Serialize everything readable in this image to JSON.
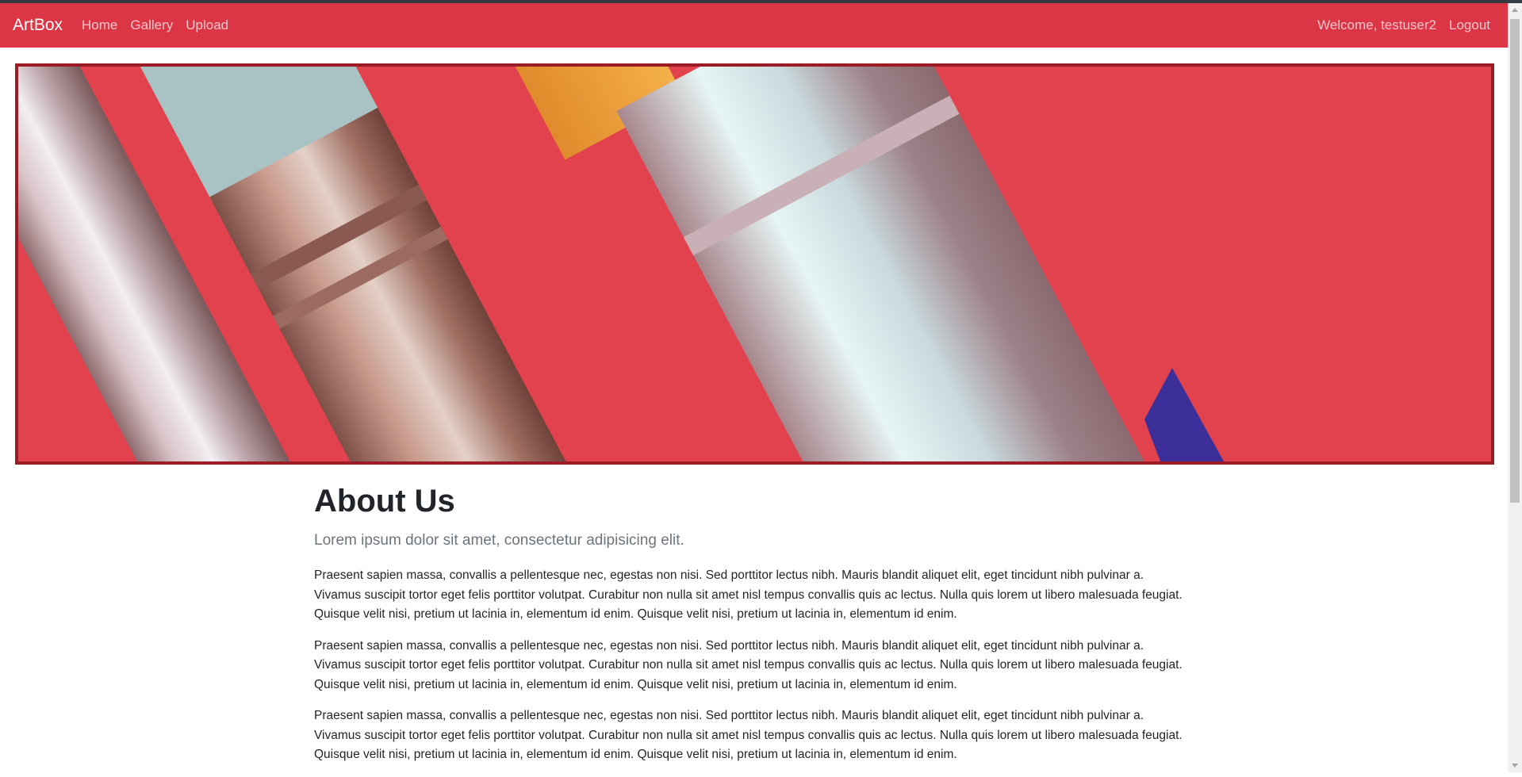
{
  "navbar": {
    "brand": "ArtBox",
    "links": [
      "Home",
      "Gallery",
      "Upload"
    ],
    "welcome": "Welcome, testuser2",
    "logout": "Logout",
    "color": "#dc3545"
  },
  "hero": {
    "border_color": "#9b1c24"
  },
  "about": {
    "heading": "About Us",
    "lead": "Lorem ipsum dolor sit amet, consectetur adipisicing elit.",
    "paragraphs": [
      "Praesent sapien massa, convallis a pellentesque nec, egestas non nisi. Sed porttitor lectus nibh. Mauris blandit aliquet elit, eget tincidunt nibh pulvinar a. Vivamus suscipit tortor eget felis porttitor volutpat. Curabitur non nulla sit amet nisl tempus convallis quis ac lectus. Nulla quis lorem ut libero malesuada feugiat. Quisque velit nisi, pretium ut lacinia in, elementum id enim. Quisque velit nisi, pretium ut lacinia in, elementum id enim.",
      "Praesent sapien massa, convallis a pellentesque nec, egestas non nisi. Sed porttitor lectus nibh. Mauris blandit aliquet elit, eget tincidunt nibh pulvinar a. Vivamus suscipit tortor eget felis porttitor volutpat. Curabitur non nulla sit amet nisl tempus convallis quis ac lectus. Nulla quis lorem ut libero malesuada feugiat. Quisque velit nisi, pretium ut lacinia in, elementum id enim. Quisque velit nisi, pretium ut lacinia in, elementum id enim.",
      "Praesent sapien massa, convallis a pellentesque nec, egestas non nisi. Sed porttitor lectus nibh. Mauris blandit aliquet elit, eget tincidunt nibh pulvinar a. Vivamus suscipit tortor eget felis porttitor volutpat. Curabitur non nulla sit amet nisl tempus convallis quis ac lectus. Nulla quis lorem ut libero malesuada feugiat. Quisque velit nisi, pretium ut lacinia in, elementum id enim. Quisque velit nisi, pretium ut lacinia in, elementum id enim."
    ]
  }
}
